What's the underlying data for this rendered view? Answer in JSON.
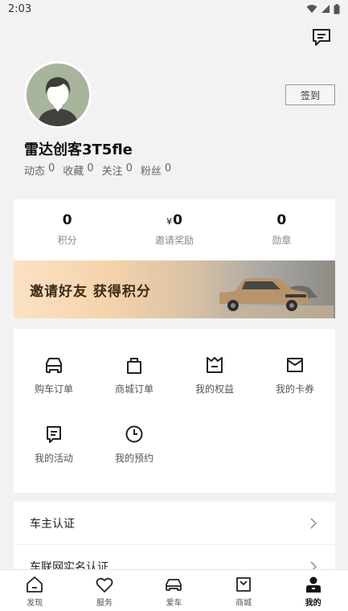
{
  "status_bar": {
    "time": "2:03"
  },
  "profile": {
    "username": "雷达创客3T5fle",
    "checkin_label": "签到",
    "stats": [
      {
        "label": "动态",
        "value": "0"
      },
      {
        "label": "收藏",
        "value": "0"
      },
      {
        "label": "关注",
        "value": "0"
      },
      {
        "label": "粉丝",
        "value": "0"
      }
    ]
  },
  "points": [
    {
      "value": "0",
      "prefix": "",
      "label": "积分"
    },
    {
      "value": "0",
      "prefix": "¥",
      "label": "邀请奖励"
    },
    {
      "value": "0",
      "prefix": "",
      "label": "勋章"
    }
  ],
  "banner": {
    "text": "邀请好友 获得积分"
  },
  "orders": [
    {
      "label": "购车订单",
      "icon": "car-order-icon"
    },
    {
      "label": "商城订单",
      "icon": "shopping-bag-icon"
    },
    {
      "label": "我的权益",
      "icon": "rights-icon"
    },
    {
      "label": "我的卡券",
      "icon": "coupon-icon"
    },
    {
      "label": "我的活动",
      "icon": "activity-icon"
    },
    {
      "label": "我的预约",
      "icon": "clock-icon"
    }
  ],
  "list": [
    {
      "label": "车主认证"
    },
    {
      "label": "车联网实名认证"
    }
  ],
  "nav": [
    {
      "label": "发现",
      "icon": "home-icon"
    },
    {
      "label": "服务",
      "icon": "heart-icon"
    },
    {
      "label": "爱车",
      "icon": "car-icon"
    },
    {
      "label": "商城",
      "icon": "mall-icon"
    },
    {
      "label": "我的",
      "icon": "profile-icon",
      "active": true
    }
  ]
}
